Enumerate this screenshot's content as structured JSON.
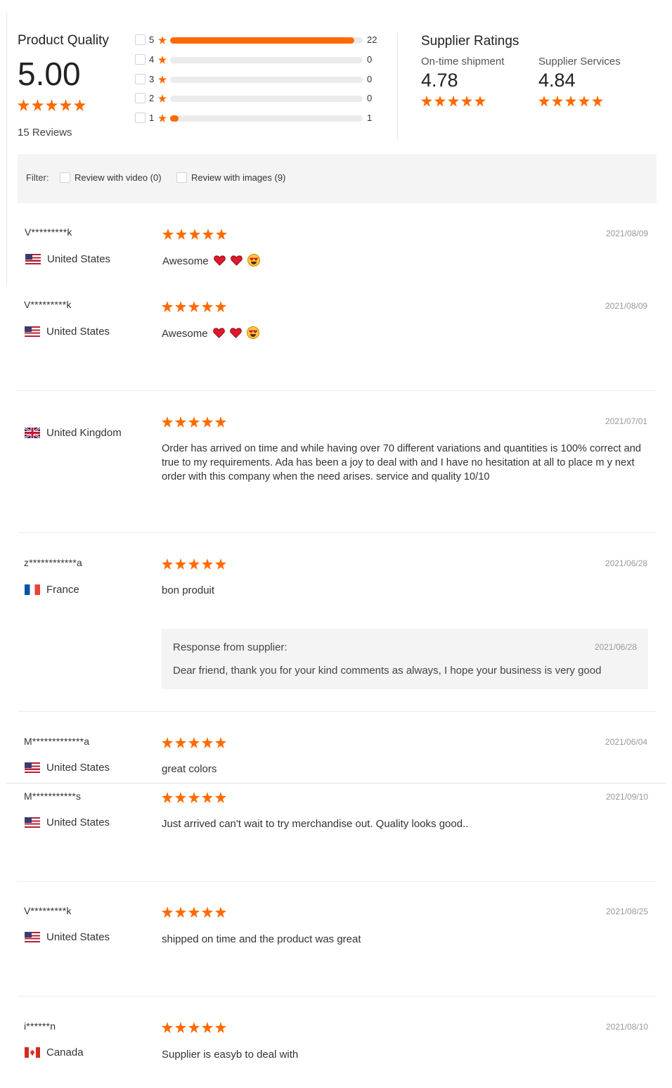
{
  "summary": {
    "product_quality_title": "Product Quality",
    "score": "5.00",
    "reviews_count": "15 Reviews",
    "distribution": [
      {
        "level": "5",
        "count": "22",
        "fraction": 0.955
      },
      {
        "level": "4",
        "count": "0",
        "fraction": 0
      },
      {
        "level": "3",
        "count": "0",
        "fraction": 0
      },
      {
        "level": "2",
        "count": "0",
        "fraction": 0
      },
      {
        "level": "1",
        "count": "1",
        "fraction": 0.045
      }
    ],
    "supplier_ratings_title": "Supplier Ratings",
    "ontime_label": "On-time shipment",
    "ontime_value": "4.78",
    "services_label": "Supplier Services",
    "services_value": "4.84"
  },
  "filter": {
    "label": "Filter:",
    "video_label": "Review with video (0)",
    "images_label": "Review with images (9)"
  },
  "reviews": [
    {
      "user": "V*********k",
      "country": "United States",
      "date": "2021/08/09",
      "text": "Awesome"
    },
    {
      "user": "V*********k",
      "country": "United States",
      "date": "2021/08/09",
      "text": "Awesome"
    },
    {
      "user": "",
      "country": "United Kingdom",
      "date": "2021/07/01",
      "text": "Order has arrived on time and while having over 70 different variations and quantities is 100% correct and true to my requirements. Ada has been a joy to deal with and I have no hesitation at all to place m y next order with this company when the need arises. service and quality 10/10"
    },
    {
      "user": "z************a",
      "country": "France",
      "date": "2021/06/28",
      "text": "bon produit",
      "response": {
        "title": "Response from supplier:",
        "date": "2021/06/28",
        "text": "Dear friend, thank you for your kind comments as always, I hope your business is very good"
      }
    },
    {
      "user": "M*************a",
      "country": "United States",
      "date": "2021/06/04",
      "text": "great colors"
    },
    {
      "user": "M***********s",
      "country": "United States",
      "date": "2021/09/10",
      "text": "Just arrived can't wait to try merchandise out. Quality looks good.."
    },
    {
      "user": "V*********k",
      "country": "United States",
      "date": "2021/08/25",
      "text": "shipped on time and the product was great"
    },
    {
      "user": "i******n",
      "country": "Canada",
      "date": "2021/08/10",
      "text": "Supplier is easyb to deal with"
    }
  ],
  "colors": {
    "accent": "#ff6a00",
    "track": "#ebebeb",
    "panel": "#f4f4f4"
  },
  "icons": [
    "star-icon",
    "checkbox",
    "flag-us-icon",
    "flag-uk-icon",
    "flag-fr-icon",
    "flag-ca-icon",
    "heart-emoji-icon",
    "heart-eyes-emoji-icon"
  ]
}
